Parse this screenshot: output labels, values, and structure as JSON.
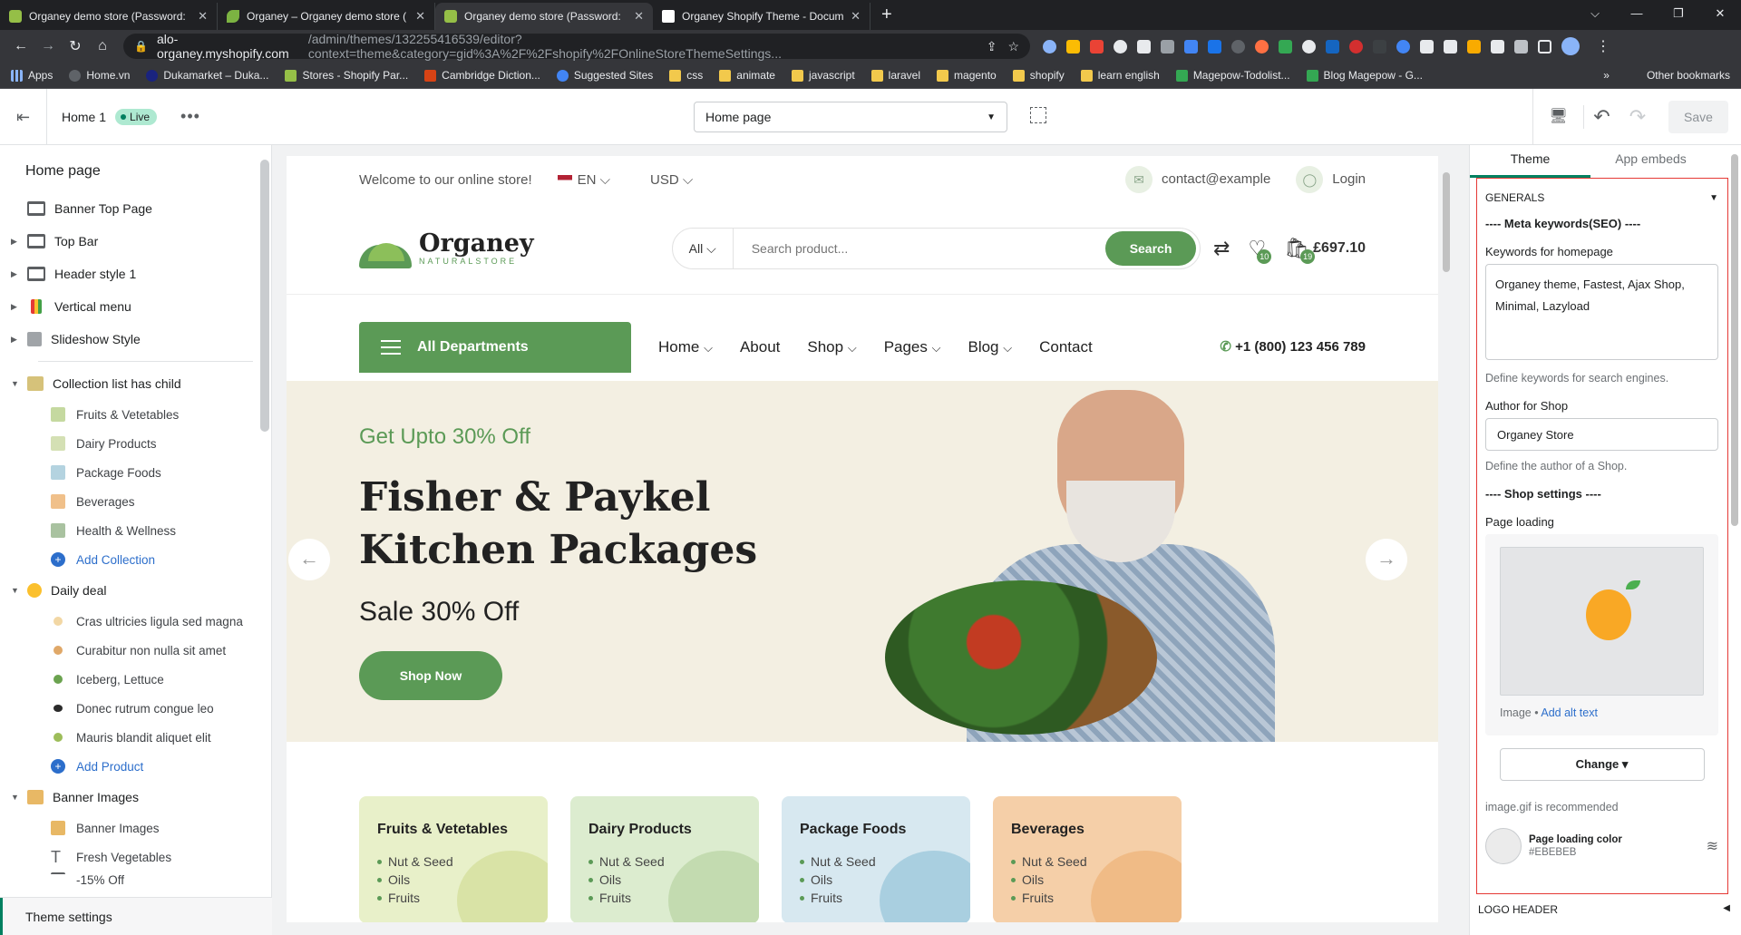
{
  "browser": {
    "tabs": [
      {
        "title": "Organey demo store (Password:",
        "active": false
      },
      {
        "title": "Organey – Organey demo store (",
        "active": false
      },
      {
        "title": "Organey demo store (Password:",
        "active": true
      },
      {
        "title": "Organey Shopify Theme - Docum",
        "active": false
      }
    ],
    "new_tab": "+",
    "url_host": "alo-organey.myshopify.com",
    "url_path": "/admin/themes/132255416539/editor?context=theme&category=gid%3A%2F%2Fshopify%2FOnlineStoreThemeSettings...",
    "bookmarks": [
      "Apps",
      "Home.vn",
      "Dukamarket – Duka...",
      "Stores - Shopify Par...",
      "Cambridge Diction...",
      "Suggested Sites",
      "css",
      "animate",
      "javascript",
      "laravel",
      "magento",
      "shopify",
      "learn english",
      "Magepow-Todolist...",
      "Blog Magepow - G..."
    ],
    "bookmarks_more": "»",
    "other_bookmarks": "Other bookmarks"
  },
  "editor": {
    "theme_name": "Home 1",
    "live_label": "Live",
    "page_select": "Home page",
    "save_label": "Save"
  },
  "left": {
    "title": "Home page",
    "sections": [
      {
        "label": "Banner Top Page",
        "expand": ""
      },
      {
        "label": "Top Bar",
        "expand": "▶"
      },
      {
        "label": "Header style 1",
        "expand": "▶"
      },
      {
        "label": "Vertical menu",
        "expand": "▶"
      },
      {
        "label": "Slideshow Style",
        "expand": "▶"
      }
    ],
    "collection_group": "Collection list has child",
    "collections": [
      "Fruits & Vetetables",
      "Dairy Products",
      "Package Foods",
      "Beverages",
      "Health & Wellness"
    ],
    "add_collection": "Add Collection",
    "deal_group": "Daily deal",
    "products": [
      "Cras ultricies ligula sed magna",
      "Curabitur non nulla sit amet",
      "Iceberg, Lettuce",
      "Donec rutrum congue leo",
      "Mauris blandit aliquet elit"
    ],
    "add_product": "Add Product",
    "banner_group": "Banner Images",
    "banners": [
      "Banner Images",
      "Fresh Vegetables",
      "-15% Off"
    ],
    "footer": "Theme settings"
  },
  "store": {
    "welcome": "Welcome to our online store!",
    "lang": "EN",
    "currency": "USD",
    "contact": "contact@example",
    "login": "Login",
    "logo_name": "Organey",
    "logo_sub": "NATURALSTORE",
    "search_cat": "All",
    "search_placeholder": "Search product...",
    "search_btn": "Search",
    "wishlist_count": "10",
    "cart_count": "19",
    "cart_total": "£697.10",
    "all_departments": "All Departments",
    "menu": [
      {
        "label": "Home",
        "caret": "⌵"
      },
      {
        "label": "About",
        "caret": ""
      },
      {
        "label": "Shop",
        "caret": "⌵"
      },
      {
        "label": "Pages",
        "caret": "⌵"
      },
      {
        "label": "Blog",
        "caret": "⌵"
      },
      {
        "label": "Contact",
        "caret": ""
      }
    ],
    "phone": "+1 (800) 123 456 789",
    "hero": {
      "subtitle": "Get Upto 30% Off",
      "title": "Fisher & Paykel Kitchen Packages",
      "sale": "Sale 30% Off",
      "button": "Shop Now"
    },
    "categories": [
      {
        "name": "Fruits & Vetetables",
        "items": [
          "Nut & Seed",
          "Oils",
          "Fruits"
        ],
        "bg": "#e8f0c9",
        "blob": "#d9e3a6"
      },
      {
        "name": "Dairy Products",
        "items": [
          "Nut & Seed",
          "Oils",
          "Fruits"
        ],
        "bg": "#dceccf",
        "blob": "#c3dbb0"
      },
      {
        "name": "Package Foods",
        "items": [
          "Nut & Seed",
          "Oils",
          "Fruits"
        ],
        "bg": "#d7e8f0",
        "blob": "#a9cfe0"
      },
      {
        "name": "Beverages",
        "items": [
          "Nut & Seed",
          "Oils",
          "Fruits"
        ],
        "bg": "#f5cfa8",
        "blob": "#f0bb86"
      }
    ]
  },
  "right": {
    "tabs": [
      "Theme",
      "App embeds"
    ],
    "section": "GENERALS",
    "meta_heading": "---- Meta keywords(SEO) ----",
    "keywords_label": "Keywords for homepage",
    "keywords_value": "Organey theme, Fastest, Ajax Shop, Minimal, Lazyload",
    "keywords_help": "Define keywords for search engines.",
    "author_label": "Author for Shop",
    "author_value": "Organey Store",
    "author_help": "Define the author of a Shop.",
    "shop_heading": "---- Shop settings ----",
    "loading_label": "Page loading",
    "image_label": "Image",
    "alt_link": "Add alt text",
    "change_btn": "Change ▾",
    "gif_help": "image.gif is recommended",
    "color_label": "Page loading color",
    "color_hex": "#EBEBEB",
    "next_section": "LOGO HEADER"
  }
}
